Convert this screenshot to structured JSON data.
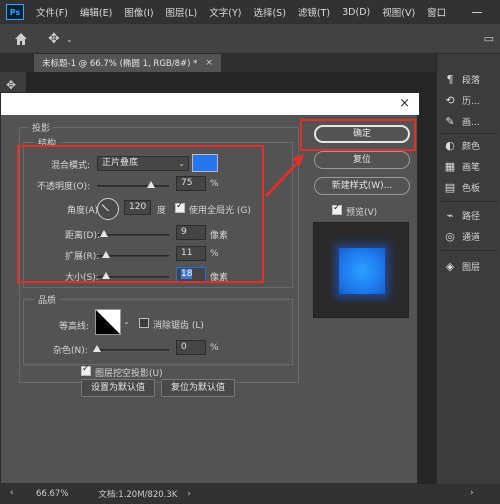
{
  "app": {
    "logo": "Ps",
    "menu": [
      "文件(F)",
      "编辑(E)",
      "图像(I)",
      "图层(L)",
      "文字(Y)",
      "选择(S)",
      "滤镜(T)",
      "3D(D)",
      "视图(V)",
      "窗口"
    ]
  },
  "document_tab": {
    "title": "未标题-1 @ 66.7% (椭圆 1, RGB/8#) *",
    "close": "×"
  },
  "right_panels": [
    {
      "icon": "paragraph-icon",
      "glyph": "¶",
      "label": "段落"
    },
    {
      "icon": "history-icon",
      "glyph": "⟲",
      "label": "历..."
    },
    {
      "icon": "brush-icon",
      "glyph": "✎",
      "label": "画..."
    },
    {
      "icon": "color-icon",
      "glyph": "◐",
      "label": "颜色"
    },
    {
      "icon": "brushes-icon",
      "glyph": "▦",
      "label": "画笔"
    },
    {
      "icon": "swatches-icon",
      "glyph": "▤",
      "label": "色板"
    },
    {
      "icon": "paths-icon",
      "glyph": "⌁",
      "label": "路径"
    },
    {
      "icon": "channels-icon",
      "glyph": "◎",
      "label": "通道"
    },
    {
      "icon": "layers-icon",
      "glyph": "◈",
      "label": "图层"
    }
  ],
  "status": {
    "zoom": "66.67%",
    "doc": "文档:1.20M/820.3K",
    "arrow": "›"
  },
  "dialog": {
    "close": "×",
    "section_title": "投影",
    "structure": {
      "title": "结构",
      "blend_mode_label": "混合模式:",
      "blend_mode_value": "正片叠底",
      "blend_color": "#2875f0",
      "opacity_label": "不透明度(O):",
      "opacity_value": "75",
      "opacity_unit": "%",
      "opacity_level": 0.75,
      "angle_label": "角度(A):",
      "angle_value": "120",
      "angle_unit": "度",
      "global_light_label": "使用全局光 (G)",
      "global_light_checked": true,
      "distance_label": "距离(D):",
      "distance_value": "9",
      "distance_unit": "像素",
      "spread_label": "扩展(R):",
      "spread_value": "11",
      "spread_unit": "%",
      "size_label": "大小(S):",
      "size_value": "18",
      "size_unit": "像素"
    },
    "quality": {
      "title": "品质",
      "contour_label": "等高线:",
      "antialias_label": "消除锯齿 (L)",
      "antialias_checked": false,
      "noise_label": "杂色(N):",
      "noise_value": "0",
      "noise_unit": "%"
    },
    "knockout_label": "图层挖空投影(U)",
    "knockout_checked": true,
    "set_default_button": "设置为默认值",
    "reset_default_button": "复位为默认值",
    "ok_button": "确定",
    "reset_button": "复位",
    "new_style_button": "新建样式(W)...",
    "preview_label": "预览(V)",
    "preview_checked": true
  },
  "highlight_color": "#e0302a"
}
